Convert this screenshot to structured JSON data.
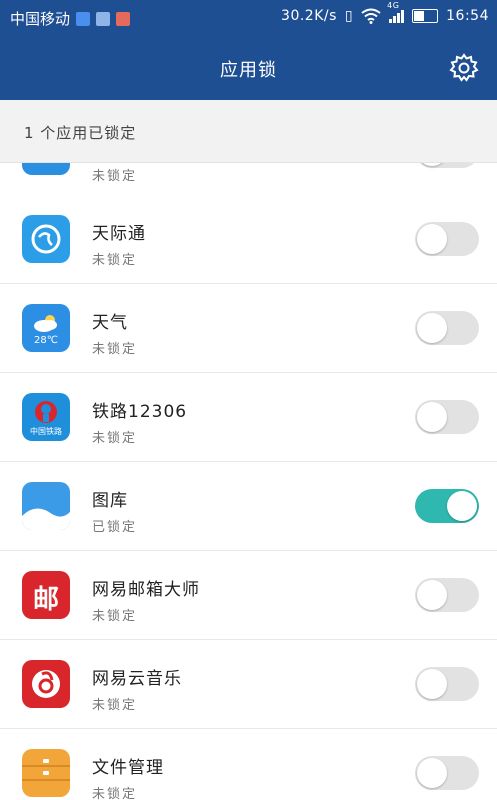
{
  "status_bar": {
    "carrier": "中国移动",
    "speed": "30.2K/s",
    "network": "4G",
    "time": "16:54"
  },
  "header": {
    "title": "应用锁",
    "settings_icon": "gear-icon"
  },
  "summary": {
    "text": "1 个应用已锁定"
  },
  "apps": [
    {
      "name": "",
      "status": "未锁定",
      "locked": false,
      "icon": "edit-app-icon",
      "color": "#2a8fe0"
    },
    {
      "name": "天际通",
      "status": "未锁定",
      "locked": false,
      "icon": "globe-app-icon",
      "color": "#2c9ee8"
    },
    {
      "name": "天气",
      "status": "未锁定",
      "locked": false,
      "icon": "weather-app-icon",
      "color": "#2d8fe3",
      "badge": "28℃"
    },
    {
      "name": "铁路12306",
      "status": "未锁定",
      "locked": false,
      "icon": "railway-app-icon",
      "color": "#1f8fdc",
      "badge": "中国铁路"
    },
    {
      "name": "图库",
      "status": "已锁定",
      "locked": true,
      "icon": "gallery-app-icon",
      "color": "#3b9be6"
    },
    {
      "name": "网易邮箱大师",
      "status": "未锁定",
      "locked": false,
      "icon": "mail-app-icon",
      "color": "#d9262c",
      "badge": "邮"
    },
    {
      "name": "网易云音乐",
      "status": "未锁定",
      "locked": false,
      "icon": "music-app-icon",
      "color": "#d8262b"
    },
    {
      "name": "文件管理",
      "status": "未锁定",
      "locked": false,
      "icon": "files-app-icon",
      "color": "#f2a63a"
    }
  ]
}
